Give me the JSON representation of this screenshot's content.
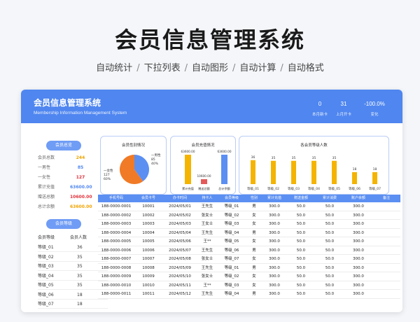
{
  "promo": {
    "title": "会员信息管理系统",
    "features": [
      "自动统计",
      "下拉列表",
      "自动图形",
      "自动计算",
      "自动格式"
    ],
    "separator": "/"
  },
  "header": {
    "title": "会员信息管理系统",
    "subtitle": "Membership Information Management System",
    "kpis": [
      {
        "value": "0",
        "label": "本月新卡"
      },
      {
        "value": "31",
        "label": "上月开卡"
      },
      {
        "value": "-100.0%",
        "label": "变化"
      }
    ]
  },
  "sidebar": {
    "stats_button": "会员总览",
    "stats": [
      {
        "label": "会员总数",
        "value": "244",
        "color": "#f0a400"
      },
      {
        "label": "一男性",
        "value": "85",
        "color": "#4f86f0"
      },
      {
        "label": "一女性",
        "value": "127",
        "color": "#e0303a"
      },
      {
        "label": "累计充值",
        "value": "63600.00",
        "color": "#4f86f0"
      },
      {
        "label": "赠送总额",
        "value": "10600.00",
        "color": "#e0303a"
      },
      {
        "label": "总计余额",
        "value": "63600.00",
        "color": "#f0a400"
      }
    ],
    "level_button": "会员等级",
    "level_headers": [
      "会员等级",
      "会员人数"
    ],
    "levels": [
      {
        "name": "等级_01",
        "count": "36"
      },
      {
        "name": "等级_02",
        "count": "35"
      },
      {
        "name": "等级_03",
        "count": "35"
      },
      {
        "name": "等级_04",
        "count": "35"
      },
      {
        "name": "等级_05",
        "count": "35"
      },
      {
        "name": "等级_06",
        "count": "18"
      },
      {
        "name": "等级_07",
        "count": "18"
      }
    ]
  },
  "chart_data": [
    {
      "type": "pie",
      "title": "会员性别情况",
      "categories": [
        "一男性",
        "一女性"
      ],
      "values": [
        85,
        127
      ],
      "data_labels": [
        "一男性, 85, 40%",
        "一女性, 127, 60%"
      ],
      "colors": [
        "#5b8ff2",
        "#f07a26"
      ]
    },
    {
      "type": "bar",
      "title": "会员充值情况",
      "categories": [
        "累计充值",
        "赠送总额",
        "总计余额"
      ],
      "values": [
        63600,
        10600,
        63600
      ],
      "data_labels": [
        "63600.00",
        "10600.00",
        "63600.00"
      ],
      "colors": [
        "#f4b400",
        "#e45a5a",
        "#5b8ff2"
      ]
    },
    {
      "type": "bar",
      "title": "各会员等级人数",
      "categories": [
        "等级_01",
        "等级_02",
        "等级_03",
        "等级_04",
        "等级_05",
        "等级_06",
        "等级_07"
      ],
      "values": [
        36,
        35,
        35,
        35,
        35,
        18,
        18
      ],
      "color": "#f4b400"
    }
  ],
  "table": {
    "headers": [
      "手机号码",
      "会员卡号",
      "办卡时间",
      "持卡人",
      "会员等级",
      "性别",
      "累计充值",
      "赠送金额",
      "累计消费",
      "账户余额",
      "备注"
    ],
    "rows": [
      [
        "188-0000-0001",
        "10001",
        "2024/05/01",
        "王先生",
        "等级_01",
        "男",
        "300.0",
        "50.0",
        "50.0",
        "300.0",
        ""
      ],
      [
        "188-0000-0002",
        "10002",
        "2024/05/02",
        "张女士",
        "等级_02",
        "女",
        "300.0",
        "50.0",
        "50.0",
        "300.0",
        ""
      ],
      [
        "188-0000-0003",
        "10003",
        "2024/05/03",
        "王女士",
        "等级_03",
        "女",
        "300.0",
        "50.0",
        "50.0",
        "300.0",
        ""
      ],
      [
        "188-0000-0004",
        "10004",
        "2024/05/04",
        "王先生",
        "等级_04",
        "男",
        "300.0",
        "50.0",
        "50.0",
        "300.0",
        ""
      ],
      [
        "188-0000-0005",
        "10005",
        "2024/05/06",
        "王**",
        "等级_05",
        "女",
        "300.0",
        "50.0",
        "50.0",
        "300.0",
        ""
      ],
      [
        "188-0000-0006",
        "10006",
        "2024/05/07",
        "王先生",
        "等级_06",
        "男",
        "300.0",
        "50.0",
        "50.0",
        "300.0",
        ""
      ],
      [
        "188-0000-0007",
        "10007",
        "2024/05/08",
        "张女士",
        "等级_07",
        "女",
        "300.0",
        "50.0",
        "50.0",
        "300.0",
        ""
      ],
      [
        "188-0000-0008",
        "10008",
        "2024/05/09",
        "王先生",
        "等级_01",
        "男",
        "300.0",
        "50.0",
        "50.0",
        "300.0",
        ""
      ],
      [
        "188-0000-0009",
        "10009",
        "2024/05/10",
        "张女士",
        "等级_02",
        "女",
        "300.0",
        "50.0",
        "50.0",
        "300.0",
        ""
      ],
      [
        "188-0000-0010",
        "10010",
        "2024/05/11",
        "王**",
        "等级_03",
        "女",
        "300.0",
        "50.0",
        "50.0",
        "300.0",
        ""
      ],
      [
        "188-0000-0011",
        "10011",
        "2024/05/12",
        "王先生",
        "等级_04",
        "男",
        "300.0",
        "50.0",
        "50.0",
        "300.0",
        ""
      ]
    ]
  }
}
